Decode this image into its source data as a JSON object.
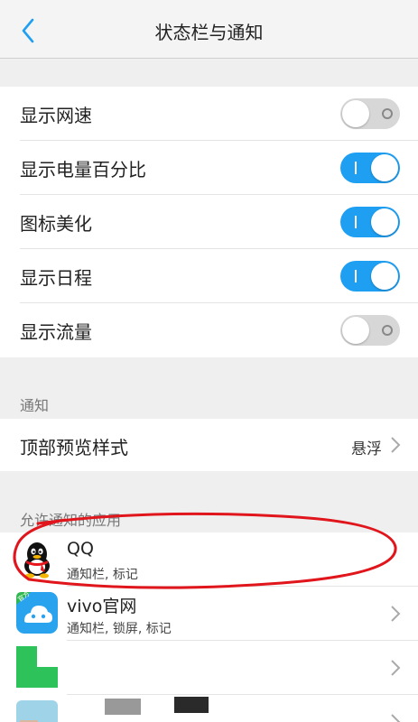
{
  "header": {
    "title": "状态栏与通知"
  },
  "toggles": [
    {
      "label": "显示网速",
      "on": false
    },
    {
      "label": "显示电量百分比",
      "on": true
    },
    {
      "label": "图标美化",
      "on": true
    },
    {
      "label": "显示日程",
      "on": true
    },
    {
      "label": "显示流量",
      "on": false
    }
  ],
  "notification": {
    "section_title": "通知",
    "preview_label": "顶部预览样式",
    "preview_value": "悬浮"
  },
  "apps": {
    "section_title": "允许通知的应用",
    "items": [
      {
        "name": "QQ",
        "sub": "通知栏, 标记",
        "icon": "qq-penguin-icon"
      },
      {
        "name": "vivo官网",
        "sub": "通知栏, 锁屏, 标记",
        "icon": "vivo-cloud-icon",
        "badge": "官方"
      },
      {
        "name": "",
        "sub": "",
        "icon": "green-app-icon"
      },
      {
        "name": "",
        "sub": "",
        "icon": "blurred-app-icon"
      }
    ]
  },
  "colors": {
    "accent": "#1e9ff2",
    "toggle_off": "#d7d7d7",
    "annotation": "#e0161c"
  }
}
